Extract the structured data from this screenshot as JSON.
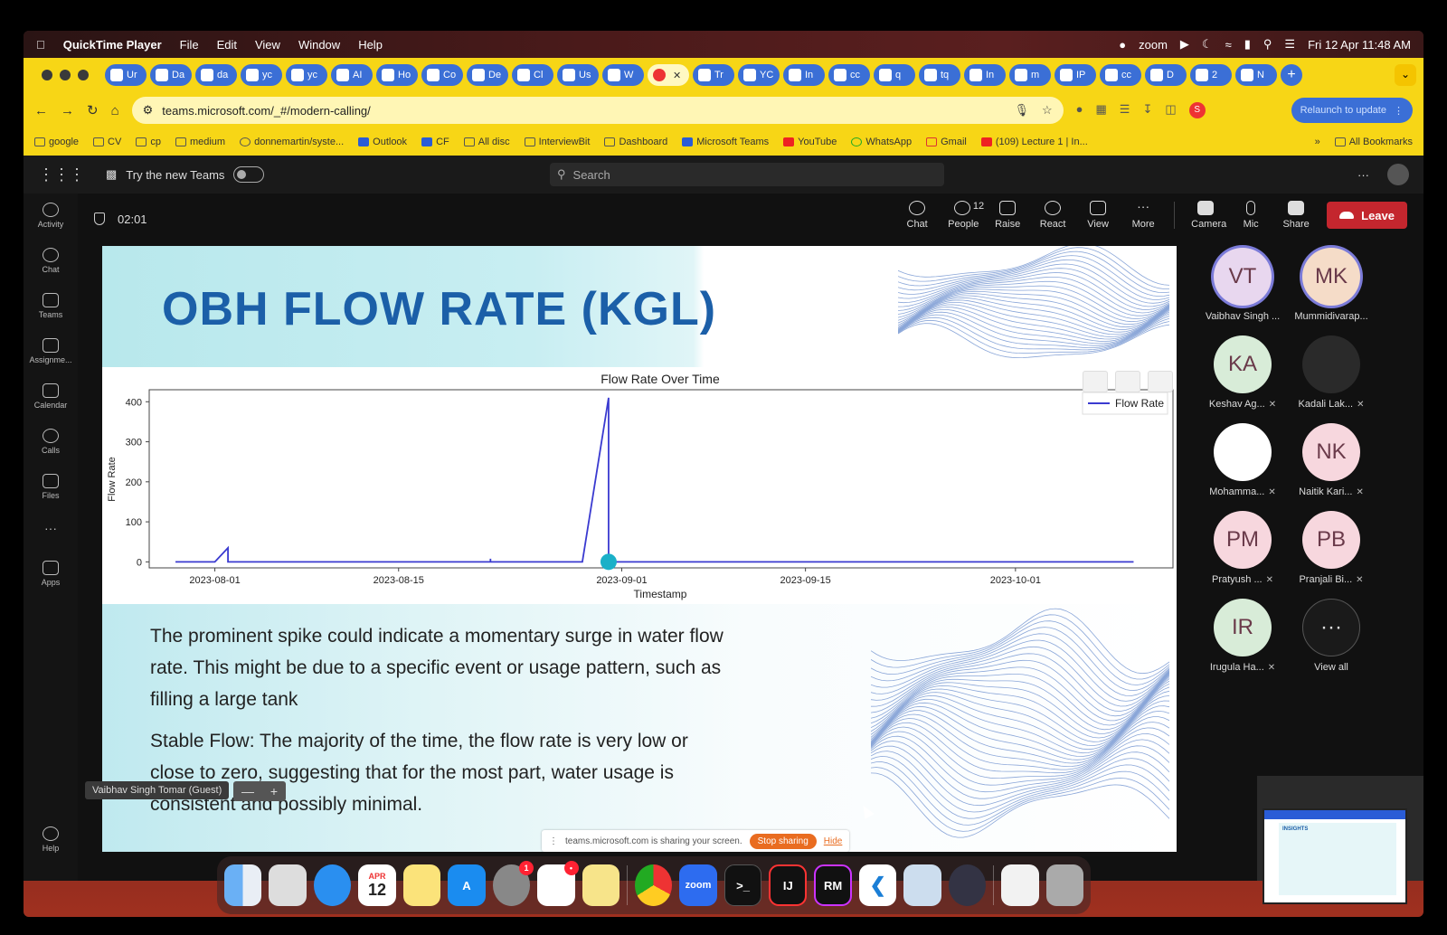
{
  "menubar": {
    "app": "QuickTime Player",
    "items": [
      "File",
      "Edit",
      "View",
      "Window",
      "Help"
    ],
    "zoom": "zoom",
    "datetime": "Fri 12 Apr  11:48 AM"
  },
  "tabs": [
    "Ur",
    "Da",
    "da",
    "yc",
    "yc",
    "AI",
    "Ho",
    "Co",
    "De",
    "Cl",
    "Us",
    "W",
    "",
    "Tr",
    "YC",
    "In",
    "cc",
    "q",
    "tq",
    "In",
    "m",
    "IP",
    "cc",
    "D",
    "2",
    "N"
  ],
  "address": {
    "url": "teams.microsoft.com/_#/modern-calling/",
    "relaunch": "Relaunch to update",
    "profile": "S"
  },
  "bookmarks": {
    "items": [
      "google",
      "CV",
      "cp",
      "medium",
      "donnemartin/syste...",
      "Outlook",
      "CF",
      "All disc",
      "InterviewBit",
      "Dashboard",
      "Microsoft Teams",
      "YouTube",
      "WhatsApp",
      "Gmail",
      "(109) Lecture 1 | In..."
    ],
    "more": "»",
    "all": "All Bookmarks"
  },
  "teams": {
    "try_new": "Try the new Teams",
    "search_placeholder": "Search",
    "more": "···"
  },
  "rail": [
    "Activity",
    "Chat",
    "Teams",
    "Assignme...",
    "Calendar",
    "Calls",
    "Files",
    "···",
    "Apps",
    "Help"
  ],
  "meeting": {
    "timer": "02:01",
    "controls": [
      "Chat",
      "People",
      "Raise",
      "React",
      "View",
      "More",
      "Camera",
      "Mic",
      "Share"
    ],
    "people_count": "12",
    "leave": "Leave"
  },
  "slide": {
    "title": "OBH FLOW RATE (KGL)",
    "para1": "The prominent spike could indicate a momentary surge in water flow rate. This might be due to a specific event or usage pattern, such as filling a large tank",
    "para2": "Stable Flow: The majority of the time, the flow rate is very low or close to zero, suggesting that for the most part, water usage is consistent and possibly minimal."
  },
  "chart_data": {
    "type": "line",
    "title": "Flow Rate Over Time",
    "xlabel": "Timestamp",
    "ylabel": "Flow Rate",
    "x_ticks": [
      "2023-08-01",
      "2023-08-15",
      "2023-09-01",
      "2023-09-15",
      "2023-10-01"
    ],
    "y_ticks": [
      0,
      100,
      200,
      300,
      400
    ],
    "xlim": [
      "2023-07-27",
      "2023-10-13"
    ],
    "ylim": [
      -15,
      430
    ],
    "series": [
      {
        "name": "Flow Rate",
        "color": "#3a3ad0",
        "x": [
          "2023-07-29",
          "2023-08-01",
          "2023-08-02",
          "2023-08-02",
          "2023-08-03",
          "2023-08-22",
          "2023-08-22",
          "2023-08-22",
          "2023-08-25",
          "2023-08-29",
          "2023-08-31",
          "2023-08-31",
          "2023-09-01",
          "2023-10-10"
        ],
        "y": [
          0,
          0,
          35,
          0,
          0,
          0,
          8,
          0,
          0,
          0,
          410,
          0,
          0,
          0
        ]
      }
    ],
    "highlight_point": {
      "x": "2023-08-31",
      "y": 0
    },
    "legend": "top-right",
    "grid": false
  },
  "share_banner": {
    "text": "teams.microsoft.com is sharing your screen.",
    "stop": "Stop sharing",
    "hide": "Hide"
  },
  "presenter": "Vaibhav Singh Tomar (Guest)",
  "zoom_ctl": {
    "minus": "—",
    "plus": "+"
  },
  "participants": [
    {
      "initials": "VT",
      "name": "Vaibhav Singh ...",
      "bg": "#e8d7ef",
      "muted": false
    },
    {
      "initials": "MK",
      "name": "Mummidivarap...",
      "bg": "#f5dcc8",
      "muted": false
    },
    {
      "initials": "KA",
      "name": "Keshav Ag...",
      "bg": "#d8ecd8",
      "muted": true
    },
    {
      "initials": "",
      "name": "Kadali Lak...",
      "bg": "#2a2a2a",
      "muted": true
    },
    {
      "initials": "",
      "name": "Mohamma...",
      "bg": "#ffffff",
      "muted": true
    },
    {
      "initials": "NK",
      "name": "Naitik Kari...",
      "bg": "#f7d7de",
      "muted": true
    },
    {
      "initials": "PM",
      "name": "Pratyush ...",
      "bg": "#f7d7de",
      "muted": true
    },
    {
      "initials": "PB",
      "name": "Pranjali Bi...",
      "bg": "#f7d7de",
      "muted": true
    },
    {
      "initials": "IR",
      "name": "Irugula Ha...",
      "bg": "#d8ecd8",
      "muted": true
    },
    {
      "initials": "···",
      "name": "View all",
      "bg": "#1a1a1a",
      "muted": false
    }
  ],
  "dock": {
    "apps": [
      "finder",
      "launchpad",
      "safari",
      "calendar",
      "notes",
      "app-store",
      "system-settings",
      "slack",
      "stickies",
      "chrome",
      "zoom",
      "terminal",
      "intellij",
      "rubymine",
      "vscode",
      "preview",
      "quicktime",
      "documents",
      "trash"
    ],
    "calendar_month": "APR",
    "calendar_day": "12",
    "zoom_label": "zoom",
    "intellij_label": "IJ",
    "rubymine_label": "RM",
    "terminal_label": ">_",
    "settings_badge": "1",
    "slack_badge": "•"
  },
  "thumb": {
    "title": "INSIGHTS"
  }
}
